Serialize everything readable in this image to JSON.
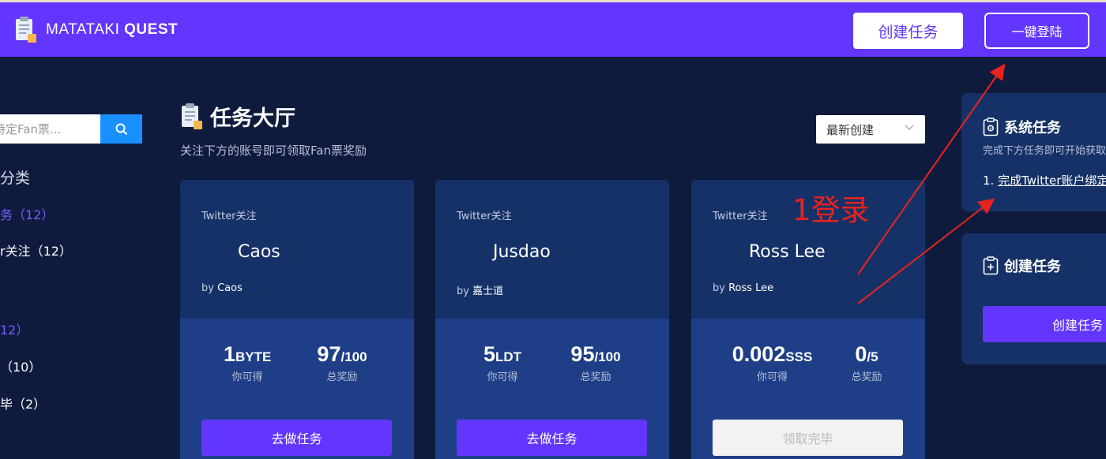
{
  "header": {
    "logo_light": "MATATAKI ",
    "logo_bold": "QUEST",
    "create_button": "创建任务",
    "login_button": "一键登陆"
  },
  "sidebar": {
    "search_placeholder": "特定Fan票...",
    "category_heading": "分类",
    "items": [
      {
        "label": "务（12）",
        "color": "#7a5cff"
      },
      {
        "label": "r关注（12）",
        "color": "#ffffff"
      },
      {
        "label": "12）",
        "color": "#7a5cff"
      },
      {
        "label": "（10）",
        "color": "#ffffff"
      },
      {
        "label": "毕（2）",
        "color": "#ffffff"
      }
    ]
  },
  "main": {
    "title": "任务大厅",
    "subtitle": "关注下方的账号即可领取Fan票奖励",
    "sort_value": "最新创建"
  },
  "cards": [
    {
      "type": "Twitter关注",
      "name": "Caos",
      "by_prefix": "by ",
      "author": "Caos",
      "earn_value": "1",
      "earn_unit": "BYTE",
      "earn_label": "你可得",
      "total_value": "97",
      "total_unit": "/100",
      "total_label": "总奖励",
      "button": "去做任务"
    },
    {
      "type": "Twitter关注",
      "name": "Jusdao",
      "by_prefix": "by ",
      "author": "嘉士道",
      "earn_value": "5",
      "earn_unit": "LDT",
      "earn_label": "你可得",
      "total_value": "95",
      "total_unit": "/100",
      "total_label": "总奖励",
      "button": "去做任务"
    },
    {
      "type": "Twitter关注",
      "name": "Ross Lee",
      "by_prefix": "by ",
      "author": "Ross Lee",
      "earn_value": "0.002",
      "earn_unit": "SSS",
      "earn_label": "你可得",
      "total_value": "0",
      "total_unit": "/5",
      "total_label": "总奖励",
      "button": "领取完毕"
    }
  ],
  "right": {
    "system_title": "系统任务",
    "system_sub": "完成下方任务即可开始获取",
    "system_link_num": "1. ",
    "system_link": "完成Twitter账户绑定",
    "create_title": "创建任务",
    "create_button": "创建任务"
  },
  "annotation": {
    "label": "1登录",
    "color": "#e8231e"
  },
  "colors": {
    "brand": "#6236ff",
    "background": "#0f1b3d",
    "card": "#163167",
    "card_bottom": "#1e3f87",
    "search_button": "#1890ff"
  }
}
